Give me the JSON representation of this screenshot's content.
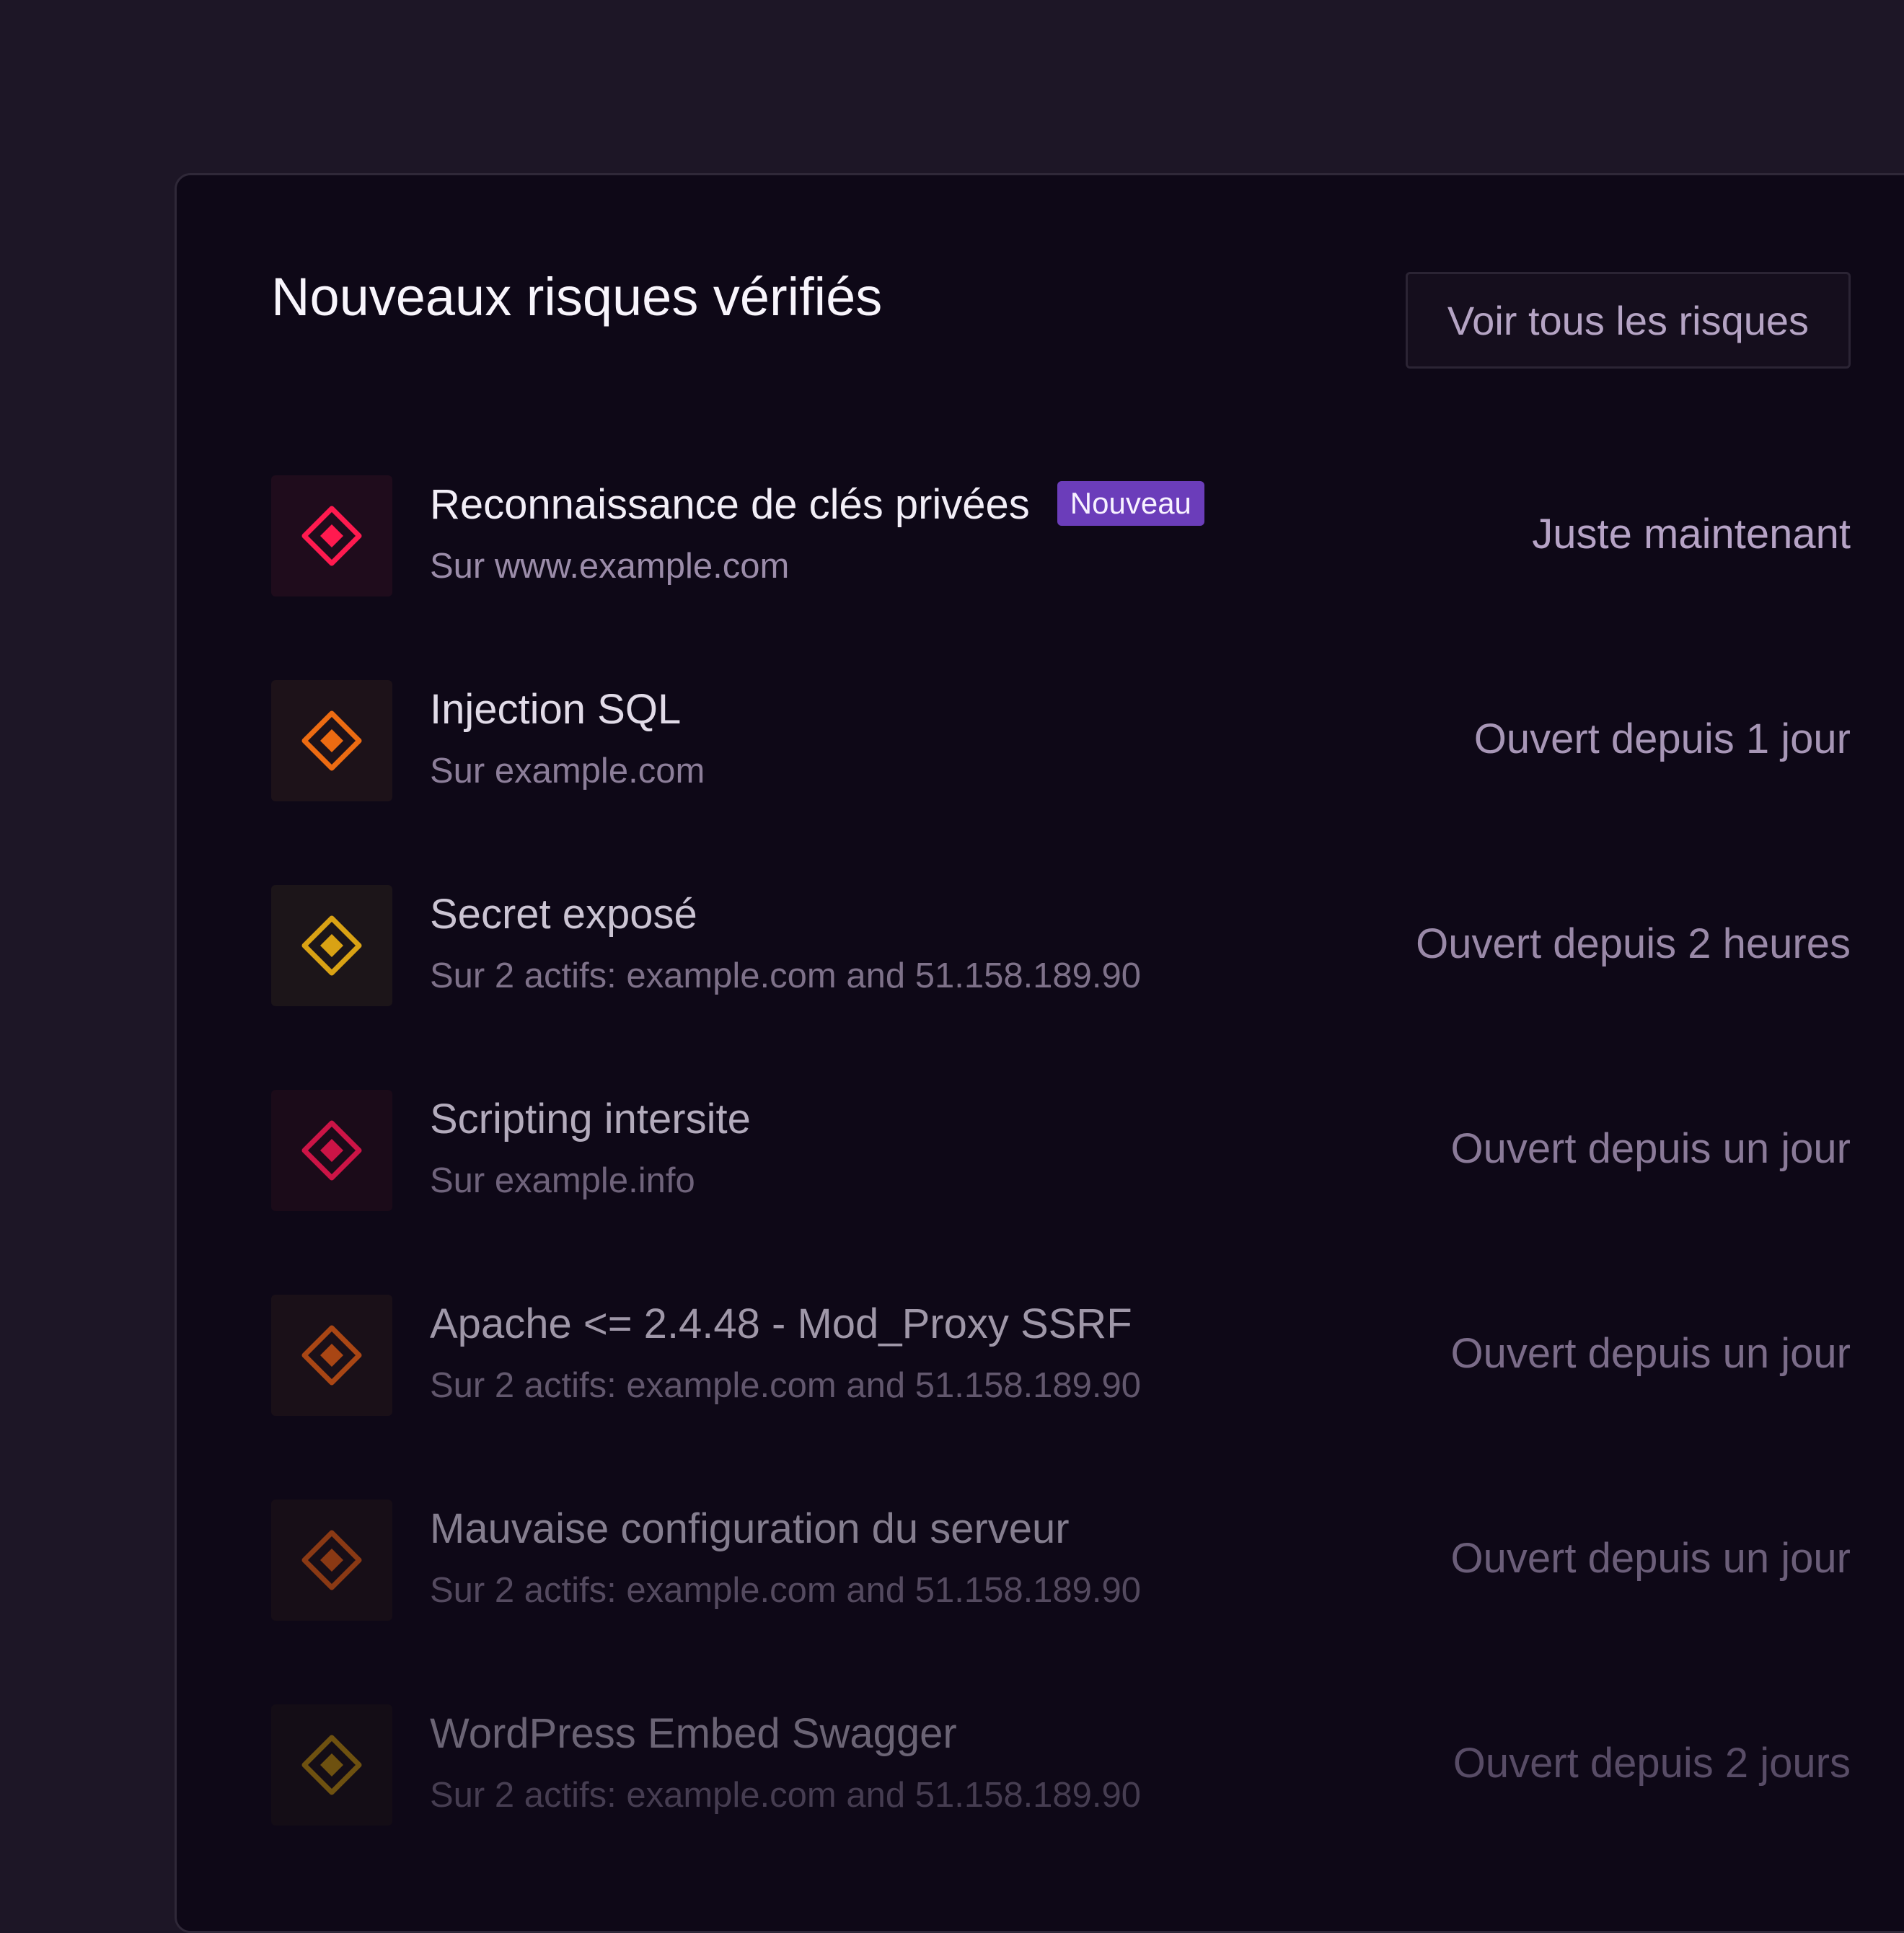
{
  "header": {
    "title": "Nouveaux risques vérifiés",
    "view_all_label": "Voir tous les risques"
  },
  "risks": [
    {
      "title": "Reconnaissance de clés privées",
      "badge": "Nouveau",
      "subtitle": "Sur www.example.com",
      "time": "Juste maintenant",
      "icon": "critical-severity-diamond-icon",
      "icon_color": "#ff1a4f",
      "icon_bg": "#1f0c1c",
      "title_color": "#f2eef7",
      "subtitle_color": "#9b8ca9",
      "time_color": "#b6a3c6"
    },
    {
      "title": "Injection SQL",
      "subtitle": "Sur example.com",
      "time": "Ouvert depuis 1 jour",
      "icon": "high-severity-diamond-icon",
      "icon_color": "#ec6b12",
      "icon_bg": "#1d1219",
      "title_color": "#e1dbe8",
      "subtitle_color": "#8c7e99",
      "time_color": "#a796b6"
    },
    {
      "title": "Secret exposé",
      "subtitle": "Sur 2 actifs: example.com and 51.158.189.90",
      "time": "Ouvert depuis 2 heures",
      "icon": "medium-severity-diamond-icon",
      "icon_color": "#d9a214",
      "icon_bg": "#1c1519",
      "title_color": "#cbc4d3",
      "subtitle_color": "#7e7189",
      "time_color": "#9a89a8"
    },
    {
      "title": "Scripting intersite",
      "subtitle": "Sur example.info",
      "time": "Ouvert depuis un jour",
      "icon": "critical-severity-diamond-icon",
      "icon_color": "#cc1446",
      "icon_bg": "#1b0b19",
      "title_color": "#b3abbc",
      "subtitle_color": "#6f637b",
      "time_color": "#8a7a98"
    },
    {
      "title": "Apache <= 2.4.48 - Mod_Proxy SSRF",
      "subtitle": "Sur 2 actifs: example.com and 51.158.189.90",
      "time": "Ouvert depuis un jour",
      "icon": "high-severity-diamond-icon",
      "icon_color": "#a94614",
      "icon_bg": "#1a1018",
      "title_color": "#9f97a8",
      "subtitle_color": "#62576d",
      "time_color": "#7b6c89"
    },
    {
      "title": "Mauvaise configuration du serveur",
      "subtitle": "Sur 2 actifs: example.com and 51.158.189.90",
      "time": "Ouvert depuis un jour",
      "icon": "high-severity-diamond-icon",
      "icon_color": "#8a3914",
      "icon_bg": "#170e17",
      "title_color": "#857e8f",
      "subtitle_color": "#544a5f",
      "time_color": "#6b5e79"
    },
    {
      "title": "WordPress Embed Swagger",
      "subtitle": "Sur 2 actifs: example.com and 51.158.189.90",
      "time": "Ouvert depuis 2 jours",
      "icon": "medium-severity-diamond-icon",
      "icon_color": "#6e5110",
      "icon_bg": "#140d16",
      "title_color": "#6b6475",
      "subtitle_color": "#463d51",
      "time_color": "#584c66"
    }
  ]
}
